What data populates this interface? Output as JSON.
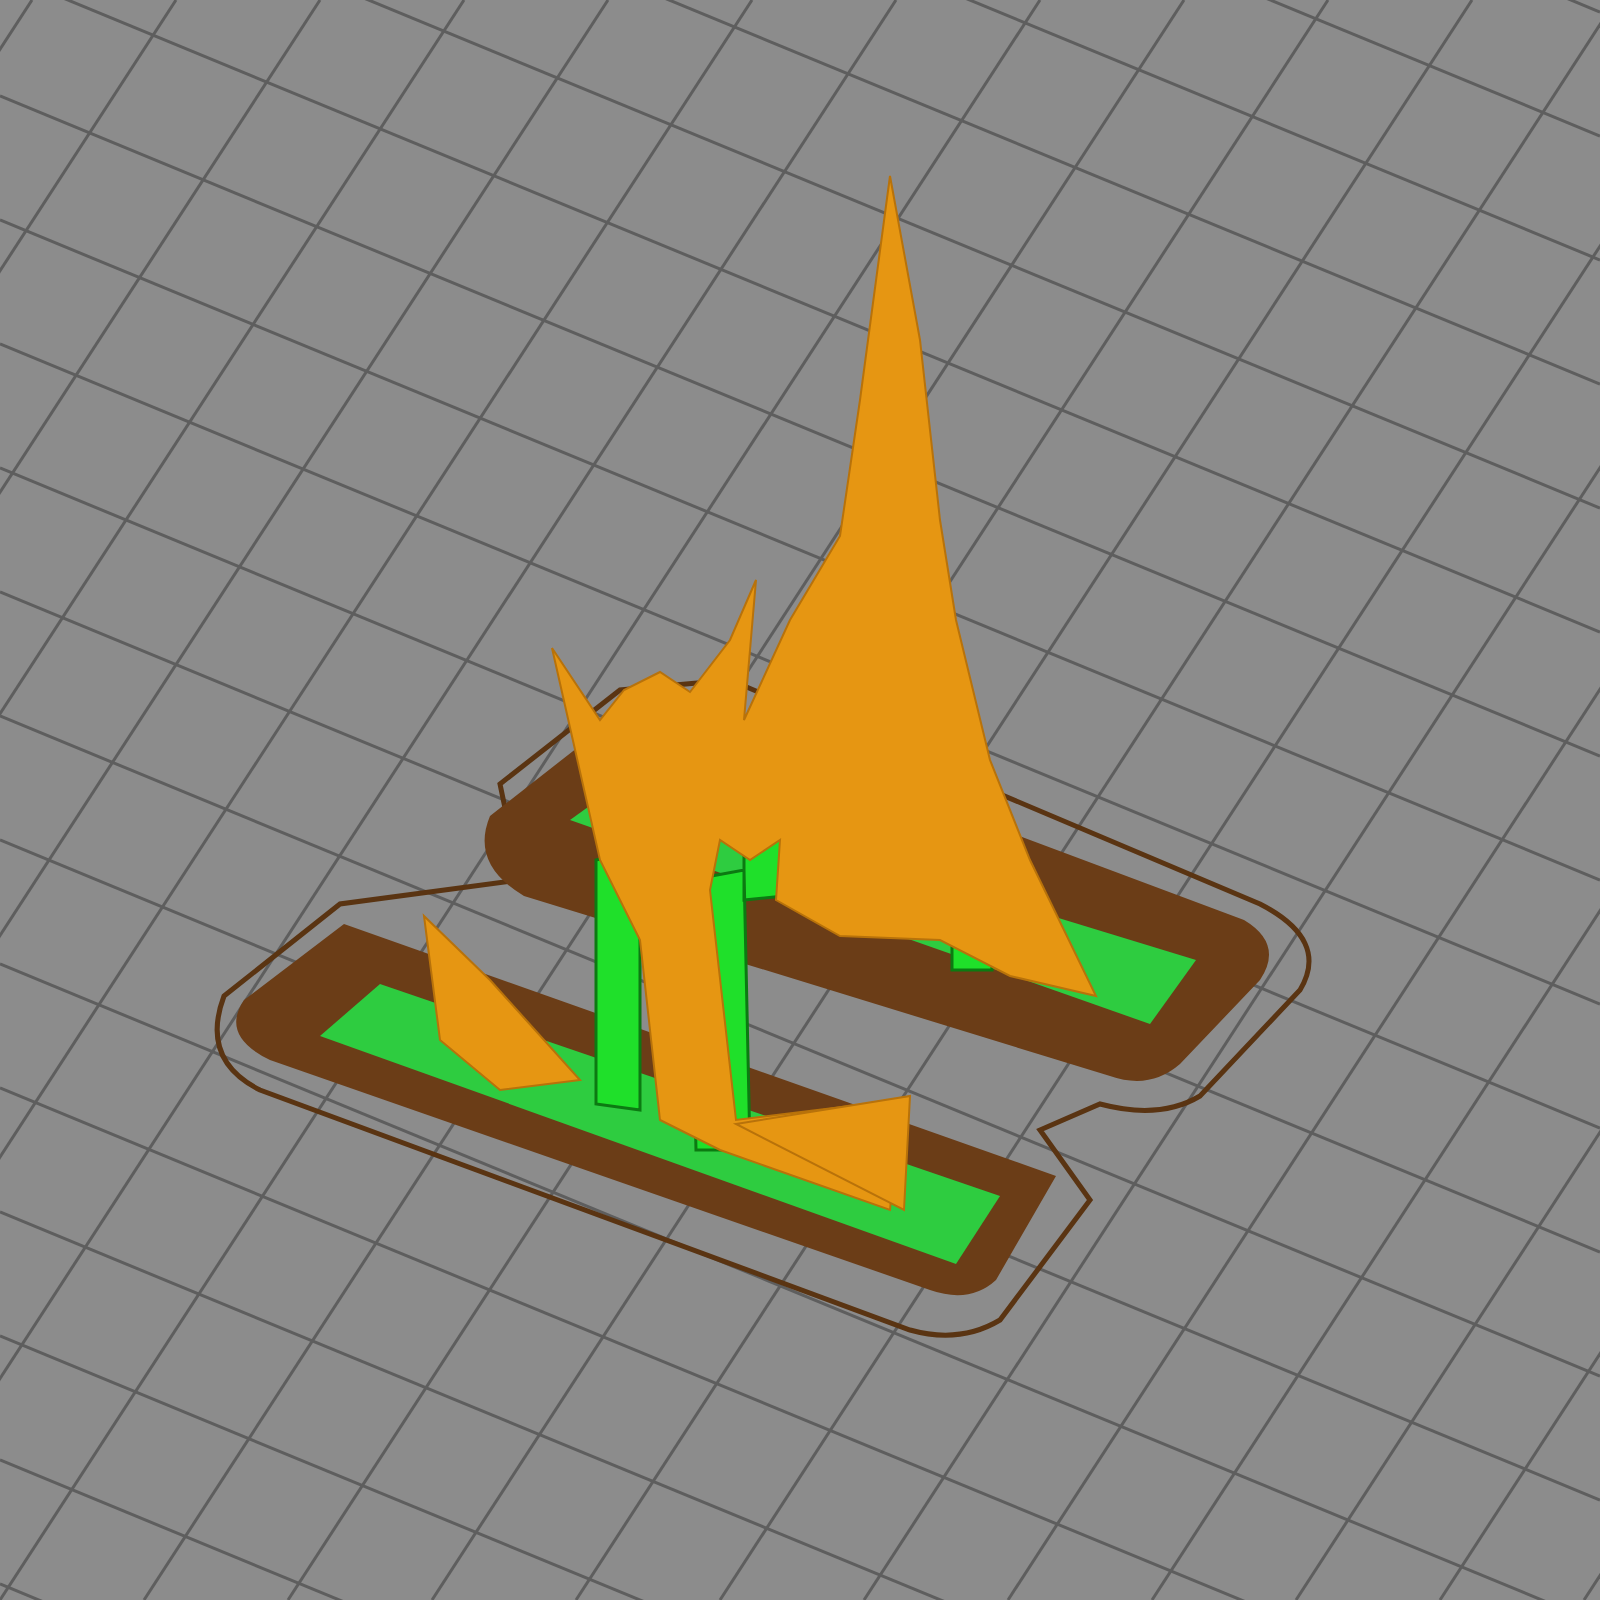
{
  "viewport": {
    "kind": "preview",
    "grid": true
  }
}
